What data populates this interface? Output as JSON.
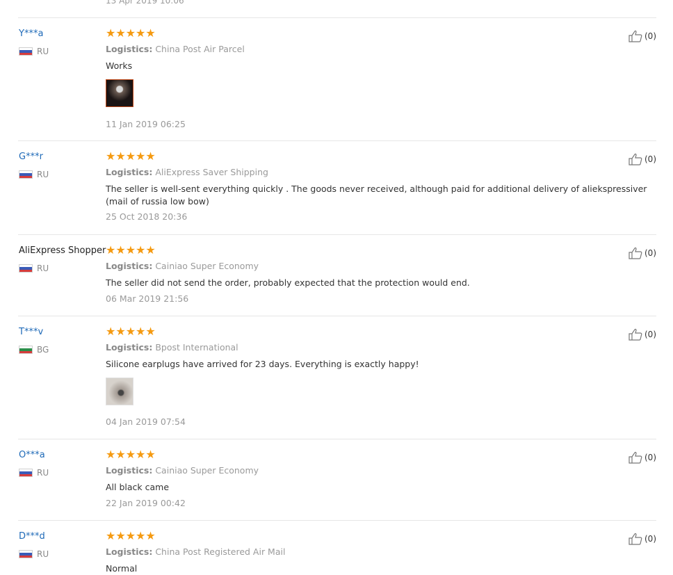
{
  "top_date": "13 Apr 2019 10:06",
  "logistics_label": "Logistics:",
  "reviews": [
    {
      "user": "Y***a",
      "country": "RU",
      "logistics": "China Post Air Parcel",
      "content": "Works",
      "has_image": true,
      "date": "11 Jan 2019 06:25",
      "likes": "(0)",
      "stars": "★★★★★"
    },
    {
      "user": "G***r",
      "country": "RU",
      "logistics": "AliExpress Saver Shipping",
      "content": "The seller is well-sent everything quickly . The goods never received, although paid for additional delivery of aliekspressiver (mail of russia low bow)",
      "has_image": false,
      "date": "25 Oct 2018 20:36",
      "likes": "(0)",
      "stars": "★★★★★"
    },
    {
      "user": "AliExpress Shopper",
      "country": "RU",
      "logistics": "Cainiao Super Economy",
      "content": "The seller did not send the order, probably expected that the protection would end.",
      "has_image": false,
      "date": "06 Mar 2019 21:56",
      "likes": "(0)",
      "stars": "★★★★★"
    },
    {
      "user": "T***v",
      "country": "BG",
      "logistics": "Bpost International",
      "content": "Silicone earplugs have arrived for 23 days. Everything is exactly happy!",
      "has_image": true,
      "date": "04 Jan 2019 07:54",
      "likes": "(0)",
      "stars": "★★★★★"
    },
    {
      "user": "O***a",
      "country": "RU",
      "logistics": "Cainiao Super Economy",
      "content": "All black came",
      "has_image": false,
      "date": "22 Jan 2019 00:42",
      "likes": "(0)",
      "stars": "★★★★★"
    },
    {
      "user": "D***d",
      "country": "RU",
      "logistics": "China Post Registered Air Mail",
      "content": "Normal",
      "has_image": false,
      "date": "",
      "likes": "(0)",
      "stars": "★★★★★"
    }
  ],
  "colors": {
    "username": "#1f6ab8",
    "stars": "#f59a11",
    "muted": "#999999",
    "separator": "#e6e6e6"
  },
  "icons": {
    "helpful": "thumbs-up-icon",
    "rating": "star-icon"
  }
}
